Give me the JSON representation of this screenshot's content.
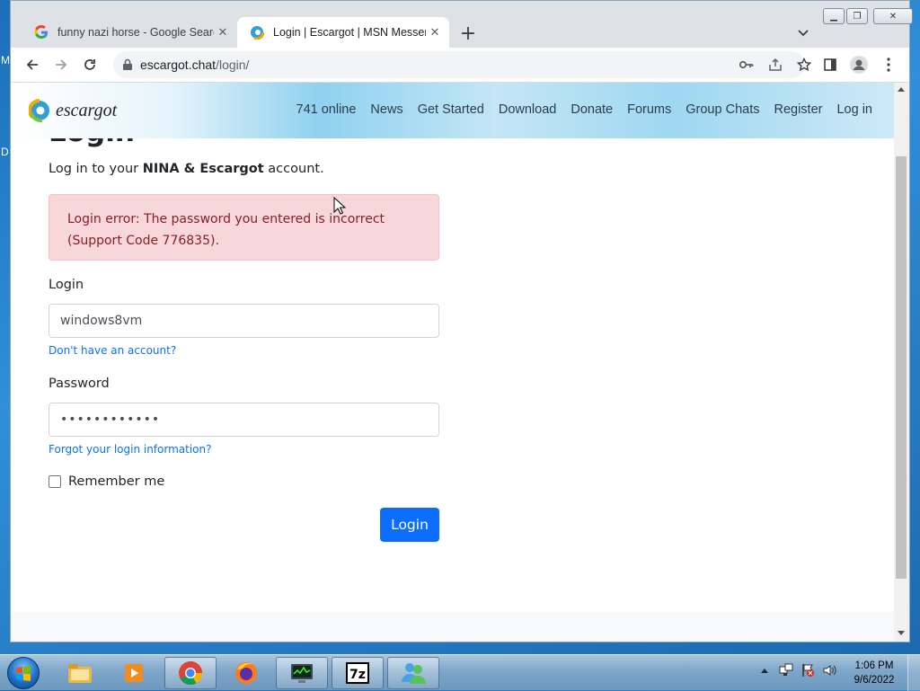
{
  "desktop": {
    "letters": [
      "M",
      "D"
    ]
  },
  "browser": {
    "tabs": [
      {
        "title": "funny nazi horse - Google Search",
        "favicon": "google-g-icon",
        "active": false
      },
      {
        "title": "Login | Escargot | MSN Messenger",
        "favicon": "escargot-logo-icon",
        "active": true
      }
    ],
    "url_host": "escargot.chat",
    "url_path": "/login/"
  },
  "site": {
    "brand": "escargot",
    "nav": [
      "741 online",
      "News",
      "Get Started",
      "Download",
      "Donate",
      "Forums",
      "Group Chats",
      "Register",
      "Log in"
    ]
  },
  "login_page": {
    "heading": "Login",
    "subtitle_prefix": "Log in to your ",
    "subtitle_bold": "NINA & Escargot",
    "subtitle_suffix": " account.",
    "error_line1": "Login error: The password you entered is incorrect",
    "error_line2": "(Support Code 776835).",
    "login_label": "Login",
    "login_value": "windows8vm",
    "no_account_link": "Don't have an account?",
    "password_label": "Password",
    "password_value": "••••••••••••",
    "forgot_link": "Forgot your login information?",
    "remember_label": "Remember me",
    "submit_label": "Login",
    "colors": {
      "primary": "#0d6efd",
      "alert_bg": "#f8d7da",
      "alert_text": "#842029"
    }
  },
  "taskbar": {
    "items": [
      "explorer-icon",
      "media-player-icon",
      "chrome-icon",
      "firefox-icon",
      "task-manager-icon",
      "7zip-icon",
      "messenger-icon"
    ],
    "clock_time": "1:06 PM",
    "clock_date": "9/6/2022"
  }
}
